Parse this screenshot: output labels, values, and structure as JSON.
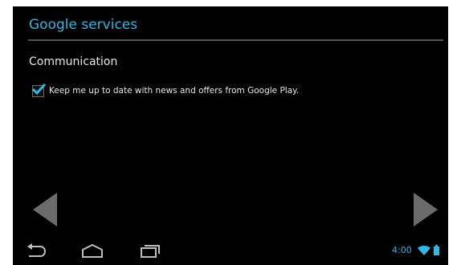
{
  "header": {
    "title": "Google services"
  },
  "communication": {
    "section_label": "Communication",
    "option": {
      "label": "Keep me up to date with news and offers from Google Play.",
      "checked": true
    }
  },
  "navigation": {
    "prev_icon": "left-triangle-arrow",
    "next_icon": "right-triangle-arrow"
  },
  "system_bar": {
    "time": "4:00",
    "icons": [
      "back-icon",
      "home-icon",
      "recents-icon",
      "wifi-icon",
      "battery-icon"
    ]
  },
  "colors": {
    "accent": "#33b5e5",
    "background": "#000000",
    "divider": "#525252",
    "arrow": "#6b6b6b"
  }
}
